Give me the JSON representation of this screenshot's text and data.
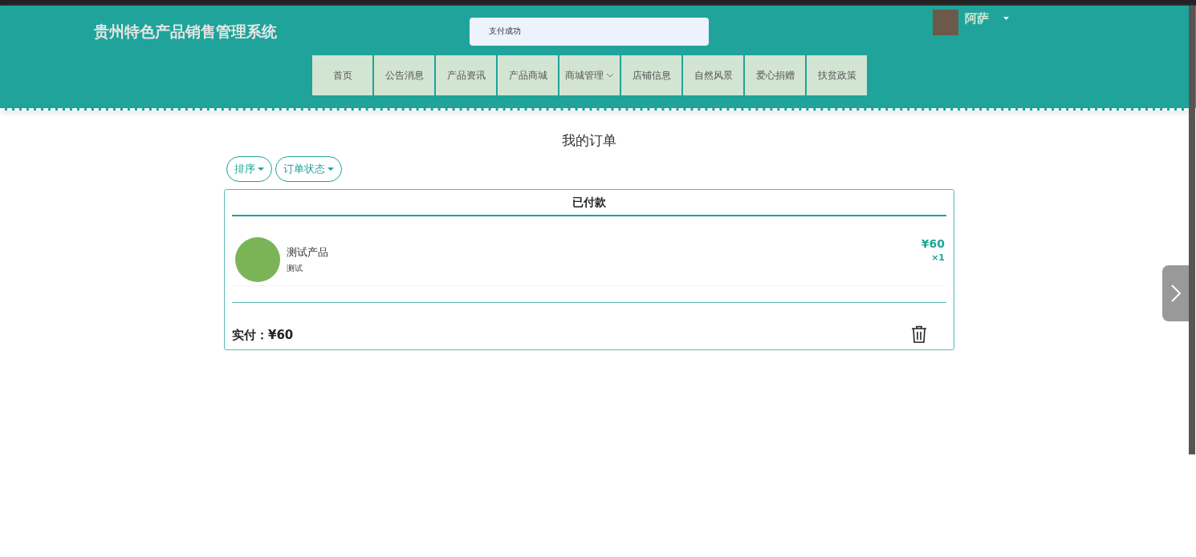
{
  "header": {
    "title": "贵州特色产品销售管理系统",
    "toast": "支付成功",
    "user": {
      "name": "阿萨"
    }
  },
  "nav": [
    {
      "label": "首页",
      "kind": "link"
    },
    {
      "label": "公告消息",
      "kind": "link"
    },
    {
      "label": "产品资讯",
      "kind": "link"
    },
    {
      "label": "产品商城",
      "kind": "link"
    },
    {
      "label": "商城管理",
      "kind": "dropdown"
    },
    {
      "label": "店铺信息",
      "kind": "link"
    },
    {
      "label": "自然风景",
      "kind": "link"
    },
    {
      "label": "爱心捐赠",
      "kind": "link"
    },
    {
      "label": "扶贫政策",
      "kind": "link"
    }
  ],
  "page": {
    "title": "我的订单",
    "filters": [
      "排序",
      "订单状态"
    ]
  },
  "orders": [
    {
      "status": "已付款",
      "items": [
        {
          "name": "测试产品",
          "desc": "测试",
          "price": "¥60",
          "qty": "×1"
        }
      ],
      "total_label": "实付：",
      "total": "¥60"
    }
  ]
}
